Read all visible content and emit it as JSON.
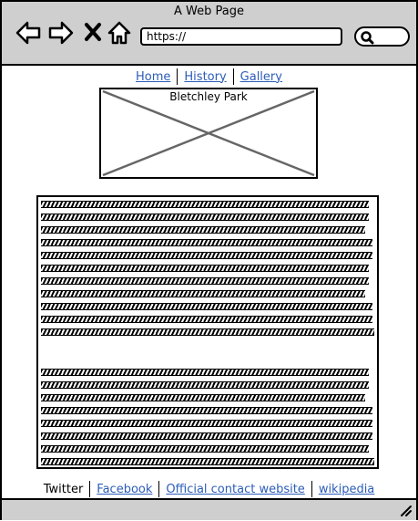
{
  "window": {
    "title": "A Web Page"
  },
  "toolbar": {
    "back_icon": "back-arrow-icon",
    "forward_icon": "forward-arrow-icon",
    "close_icon": "close-icon",
    "home_icon": "home-icon",
    "url_value": "https://",
    "search_icon": "search-icon"
  },
  "nav": {
    "links": [
      "Home",
      "History",
      "Gallery"
    ]
  },
  "image": {
    "caption": "Bletchley Park"
  },
  "footer": {
    "items": [
      "Twitter",
      "Facebook",
      "Official contact website",
      "wikipedia"
    ]
  },
  "colors": {
    "link": "#2c5db8",
    "chrome": "#cfcfcf"
  }
}
